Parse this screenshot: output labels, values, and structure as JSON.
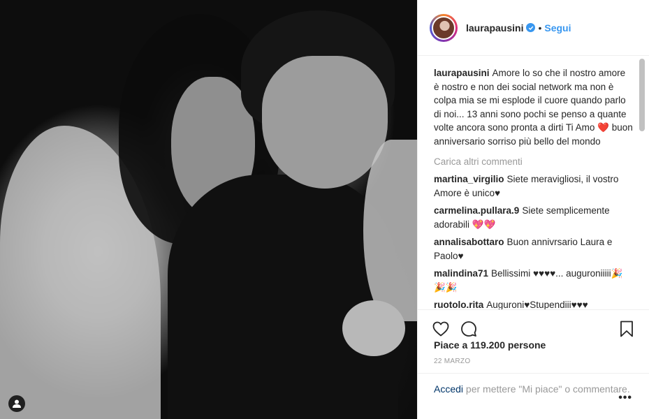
{
  "header": {
    "username": "laurapausini",
    "separator": "•",
    "follow_label": "Segui"
  },
  "caption": {
    "username": "laurapausini",
    "text": "Amore lo so che il nostro amore è nostro e non dei social network ma non è colpa mia se mi esplode il cuore quando parlo di noi... 13 anni sono pochi se penso a quante volte ancora sono pronta a dirti Ti Amo",
    "emoji": "❤️",
    "text_after": " buon anniversario sorriso più bello del mondo"
  },
  "load_more_label": "Carica altri commenti",
  "comments": [
    {
      "username": "martina_virgilio",
      "text": "Siete meravigliosi, il vostro Amore è unico♥"
    },
    {
      "username": "carmelina.pullara.9",
      "text": "Siete semplicemente adorabili",
      "emoji": "💖💖"
    },
    {
      "username": "annalisabottaro",
      "text": "Buon annivrsario Laura e Paolo♥"
    },
    {
      "username": "malindina71",
      "text": "Bellissimi ♥♥♥♥... auguroniiiii",
      "emoji": "🎉🎉🎉"
    },
    {
      "username": "ruotolo.rita",
      "text": "Auguroni♥Stupendiii♥♥♥"
    }
  ],
  "likes_text": "Piace a 119.200 persone",
  "date": "22 MARZO",
  "footer": {
    "login_label": "Accedi",
    "rest": " per mettere \"Mi piace\" o commentare."
  },
  "more_label": "•••",
  "icons": {
    "like": "heart-outline-icon",
    "comment": "speech-bubble-icon",
    "save": "bookmark-icon",
    "tag": "user-tag-icon",
    "verified": "verified-badge-icon"
  },
  "colors": {
    "link_blue": "#3897f0",
    "login_blue": "#003569",
    "muted": "#999999",
    "text": "#262626"
  }
}
